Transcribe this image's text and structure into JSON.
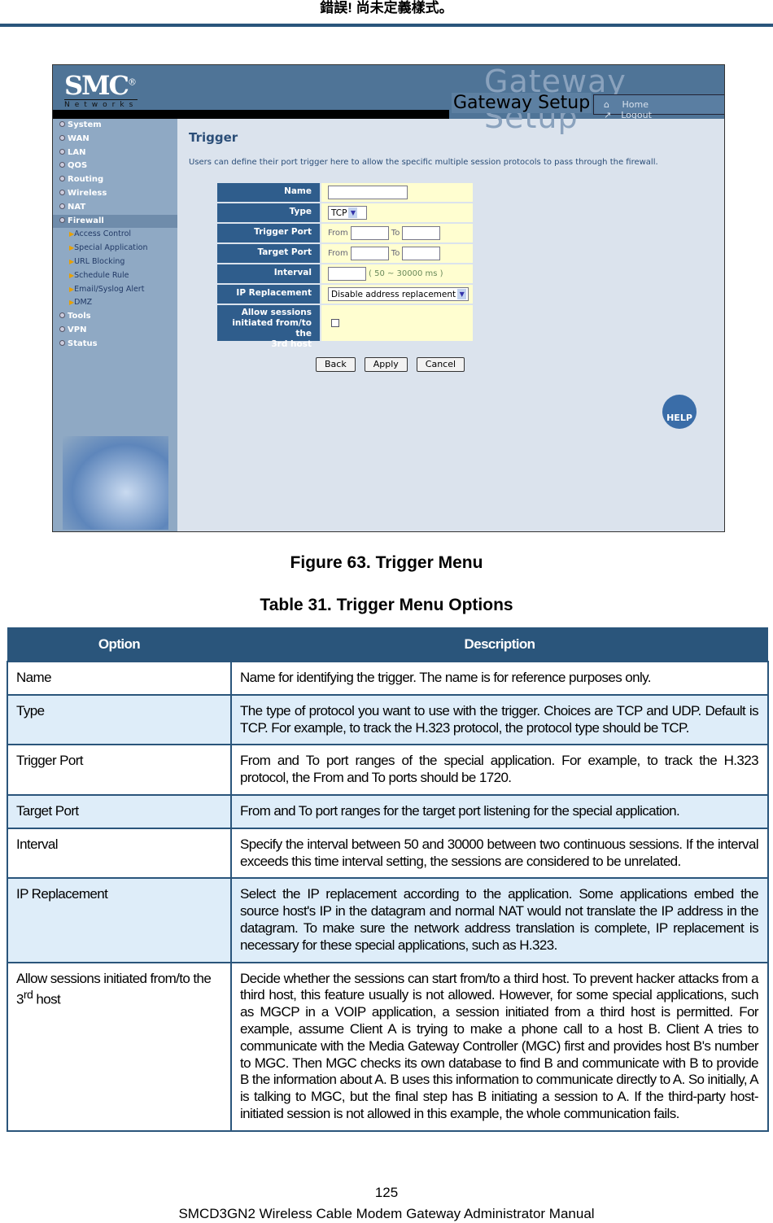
{
  "page_header": "錯誤! 尚未定義樣式。",
  "screenshot": {
    "logo": "SMC",
    "logo_sub": "Networks",
    "banner": "Gateway Setup",
    "banner_watermark": "Gateway Setup",
    "home": "Home",
    "logout": "Logout",
    "menu": [
      {
        "label": "System"
      },
      {
        "label": "WAN"
      },
      {
        "label": "LAN"
      },
      {
        "label": "QOS"
      },
      {
        "label": "Routing"
      },
      {
        "label": "Wireless"
      },
      {
        "label": "NAT"
      },
      {
        "label": "Firewall",
        "active": true
      }
    ],
    "submenu": [
      "Access Control",
      "Special Application",
      "URL Blocking",
      "Schedule Rule",
      "Email/Syslog Alert",
      "DMZ"
    ],
    "menu_after": [
      {
        "label": "Tools"
      },
      {
        "label": "VPN"
      },
      {
        "label": "Status"
      }
    ],
    "title": "Trigger",
    "description": "Users can define their port trigger here to allow the specific multiple session protocols to pass through the firewall.",
    "form": {
      "name_label": "Name",
      "type_label": "Type",
      "type_value": "TCP",
      "trigger_label": "Trigger Port",
      "target_label": "Target Port",
      "from": "From",
      "to": "To",
      "interval_label": "Interval",
      "interval_hint": "( 50 ~ 30000 ms )",
      "ip_label": "IP Replacement",
      "ip_value": "Disable address replacement",
      "allow_label_1": "Allow sessions",
      "allow_label_2": "initiated from/to the",
      "allow_label_3": "3rd host",
      "allow_checked": false
    },
    "buttons": {
      "back": "Back",
      "apply": "Apply",
      "cancel": "Cancel"
    },
    "help": "HELP"
  },
  "figure_caption": "Figure 63. Trigger Menu",
  "table_caption": "Table 31. Trigger Menu Options",
  "table": {
    "headers": [
      "Option",
      "Description"
    ],
    "rows": [
      {
        "option": "Name",
        "description": "Name for identifying the trigger. The name is for reference purposes only."
      },
      {
        "option": "Type",
        "description": "The type of protocol you want to use with the trigger. Choices are TCP and UDP. Default is TCP. For example, to track the H.323 protocol, the protocol type should be TCP."
      },
      {
        "option": "Trigger Port",
        "description": "From and To port ranges of the special application. For example, to track the H.323 protocol, the From and To ports should be 1720."
      },
      {
        "option": "Target Port",
        "description": "From and To port ranges for the target port listening for the special application."
      },
      {
        "option": "Interval",
        "description": "Specify the interval between 50 and 30000 between two continuous sessions. If the interval exceeds this time interval setting, the sessions are considered to be unrelated."
      },
      {
        "option": "IP Replacement",
        "description": "Select the IP replacement according to the application. Some applications embed the source host's IP in the datagram and normal NAT would not translate the IP address in the datagram. To make sure the network address translation is complete, IP replacement is necessary for these special applications, such as H.323."
      },
      {
        "option_pre": "Allow sessions initiated from/to the 3",
        "option_sup": "rd",
        "option_post": " host",
        "description": "Decide whether the sessions can start from/to a third host. To prevent hacker attacks from a third host, this feature usually is not allowed. However, for some special applications, such as MGCP in a VOIP application, a session initiated from a third host is permitted. For example, assume Client A is trying to make a phone call to a host B. Client A tries to communicate with the Media Gateway Controller (MGC) first and provides host B's number to MGC. Then MGC checks its own database to find B and communicate with B to provide B the information about A. B uses this information to communicate directly to A. So initially, A is talking to MGC, but the final step has B initiating a session to A. If the third-party host-initiated session is not allowed in this example, the whole communication fails."
      }
    ]
  },
  "page_number": "125",
  "footer": "SMCD3GN2 Wireless Cable Modem Gateway Administrator Manual",
  "colors": {
    "table_header": "#2a557b",
    "alt_row": "#deedf9",
    "form_label": "#2f5d8c",
    "form_value": "#fffed0"
  }
}
